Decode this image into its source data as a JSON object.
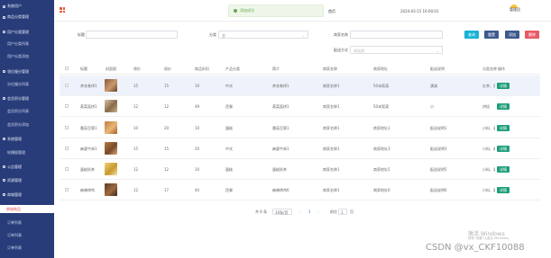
{
  "sidebar": {
    "items": [
      {
        "label": "系统用户"
      },
      {
        "label": "商品分类管理"
      },
      {
        "label": "用户分类管理"
      },
      {
        "label": "用户分类列表"
      },
      {
        "label": "用户分类添加"
      },
      {
        "label": "领位服分管理"
      },
      {
        "label": "分位服分列表"
      },
      {
        "label": "会员积分管理"
      },
      {
        "label": "会员积分列表"
      },
      {
        "label": "会员积分添加"
      },
      {
        "label": "系统管理"
      },
      {
        "label": "轮播图管理"
      },
      {
        "label": "公告管理"
      },
      {
        "label": "资源管理"
      },
      {
        "label": "商城管理"
      },
      {
        "label": "商城商品"
      },
      {
        "label": "订单列表"
      },
      {
        "label": "订单列表"
      },
      {
        "label": "订单列表"
      }
    ]
  },
  "top": {
    "toast": "添加成功",
    "title": "首页",
    "time": "2024-03-15 16:00:01",
    "user": "管理员"
  },
  "filters": {
    "name_label": "标题",
    "category_label": "分类",
    "category_value": "全",
    "search_label": "商家名称",
    "method_label": "配送方式",
    "method_placeholder": "请选择"
  },
  "buttons": {
    "search": "查询",
    "reset": "重置",
    "add": "添加",
    "delete": "删除"
  },
  "colors": {
    "sidebar": "#283c7a",
    "search": "#17b3d4",
    "reset": "#3d5a8f",
    "add": "#3d5a8f",
    "delete": "#e85b66",
    "detail": "#1f9e7a"
  },
  "table": {
    "headers": [
      "标题",
      "封面图",
      "原价",
      "现价",
      "商品折扣",
      "产品分类",
      "简介",
      "商家名称",
      "商家地址",
      "配送说明",
      "分类名称",
      "操作"
    ],
    "rows": [
      {
        "title": "茶花卷饼1",
        "price": "15",
        "now": "15",
        "discount": "10",
        "category": "中式",
        "intro": "茶花卷饼1",
        "shop": "商家名称1",
        "addr": "50米距离",
        "note": "满减",
        "cat": "红茶、家",
        "op": "详情"
      },
      {
        "title": "蒸菜面饼1",
        "price": "12",
        "now": "12",
        "discount": "49",
        "category": "西餐",
        "intro": "蒸菜面饼1",
        "shop": "商家名称1",
        "addr": "50米距离",
        "note": "小",
        "cat": "烘焙",
        "op": "详情"
      },
      {
        "title": "番茄豆腐1",
        "price": "10",
        "now": "20",
        "discount": "10",
        "category": "蛋糕",
        "intro": "番茄豆腐1",
        "shop": "商家名称1",
        "addr": "商家地址1",
        "note": "配送说明1",
        "cat": "小料、彩",
        "op": "详情"
      },
      {
        "title": "麻婆牛肉1",
        "price": "15",
        "now": "15",
        "discount": "20",
        "category": "中式",
        "intro": "麻婆牛肉1",
        "shop": "商家名称1",
        "addr": "商家地址3",
        "note": "配送说明3",
        "cat": "小料、彩",
        "op": "详情"
      },
      {
        "title": "蛋糕奶茶",
        "price": "12",
        "now": "12",
        "discount": "10",
        "category": "蛋糕",
        "intro": "蛋糕奶茶",
        "shop": "商家名称1",
        "addr": "商家地址5",
        "note": "配送说明5",
        "cat": "小料、彩",
        "op": "详情"
      },
      {
        "title": "麻辣烤鸡",
        "price": "12",
        "now": "17",
        "discount": "40",
        "category": "西餐",
        "intro": "麻辣烤鸡6",
        "shop": "商家名称1",
        "addr": "商家地址6",
        "note": "配送说明6",
        "cat": "小料、彩",
        "op": "详情"
      }
    ]
  },
  "pagination": {
    "total": "共 6 条",
    "page_size": "10条/页",
    "current": "1",
    "goto_label": "前往",
    "goto_value": "1",
    "page_suffix": "页"
  },
  "watermark": {
    "activate": "激活 Windows",
    "activate_sub": "转到\"设置\"以激活 Windows。",
    "csdn": "CSDN @vx_CKF10088"
  }
}
